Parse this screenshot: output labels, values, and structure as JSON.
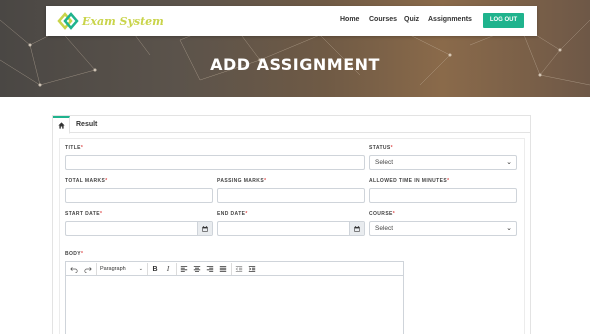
{
  "app": {
    "logo_text": "Exam System"
  },
  "nav": {
    "items": [
      {
        "label": "Home"
      },
      {
        "label": "Courses"
      },
      {
        "label": "Quiz"
      },
      {
        "label": "Assignments"
      }
    ],
    "logout_label": "LOG OUT"
  },
  "page": {
    "title": "ADD ASSIGNMENT"
  },
  "tabs": {
    "home_icon": "home-icon",
    "result_label": "Result",
    "active": "home"
  },
  "form": {
    "title_label": "TITLE",
    "title_value": "",
    "status_label": "STATUS",
    "status_value": "Select",
    "total_marks_label": "TOTAL MARKS",
    "total_marks_value": "",
    "passing_marks_label": "PASSING MARKS",
    "passing_marks_value": "",
    "allowed_time_label": "ALLOWED TIME IN MINUTES",
    "allowed_time_value": "",
    "start_date_label": "START DATE",
    "start_date_value": "",
    "end_date_label": "END DATE",
    "end_date_value": "",
    "course_label": "COURSE",
    "course_value": "Select",
    "body_label": "BODY",
    "required_mark": "*"
  },
  "editor": {
    "paragraph_label": "Paragraph",
    "toolbar_icons": [
      "undo-icon",
      "redo-icon",
      "bold-icon",
      "italic-icon",
      "align-left-icon",
      "align-center-icon",
      "align-right-icon",
      "align-justify-icon",
      "outdent-icon",
      "indent-icon"
    ],
    "bold_glyph": "B",
    "italic_glyph": "I"
  },
  "colors": {
    "accent": "#1fb38d",
    "logo": "#c9d44a",
    "required": "#e05050"
  }
}
